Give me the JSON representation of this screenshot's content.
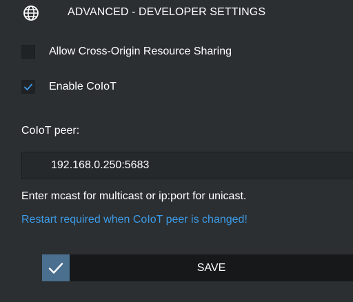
{
  "header": {
    "icon": "globe-icon",
    "title": "ADVANCED - DEVELOPER SETTINGS"
  },
  "options": {
    "cors": {
      "label": "Allow Cross-Origin Resource Sharing",
      "checked": false
    },
    "coiot": {
      "label": "Enable CoIoT",
      "checked": true
    }
  },
  "peer": {
    "label": "CoIoT peer:",
    "value": "192.168.0.250:5683",
    "help": "Enter mcast for multicast or ip:port for unicast.",
    "warning": "Restart required when CoIoT peer is changed!"
  },
  "save": {
    "label": "SAVE",
    "icon": "checkmark-icon"
  },
  "colors": {
    "background": "#2b2f31",
    "accent": "#4a6f8f",
    "warning": "#3d9be9",
    "checkmark": "#3d9be9"
  }
}
